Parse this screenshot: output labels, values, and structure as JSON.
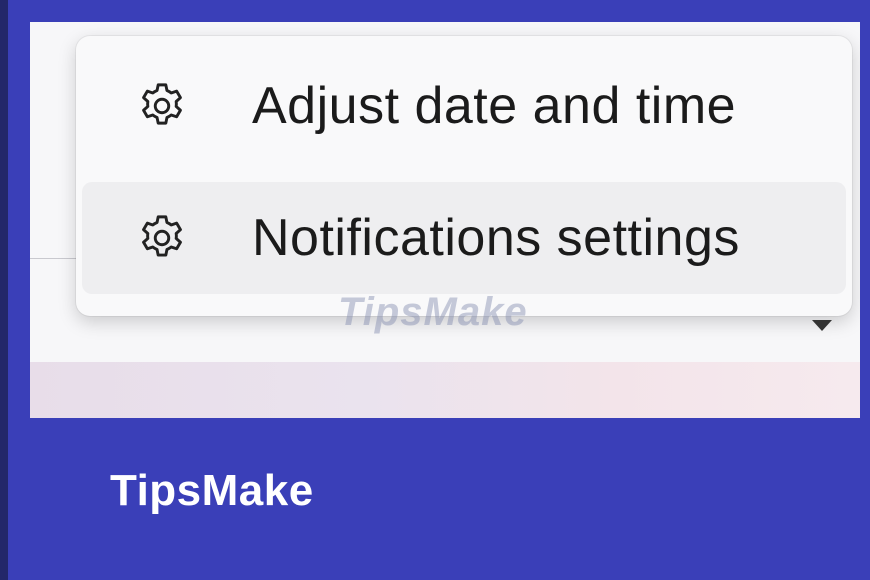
{
  "menu": {
    "items": [
      {
        "label": "Adjust date and time",
        "icon": "gear-icon"
      },
      {
        "label": "Notifications settings",
        "icon": "gear-icon"
      }
    ]
  },
  "watermark": {
    "text": "TipsMake"
  },
  "brand": {
    "text": "TipsMake"
  },
  "clock": {
    "partial_text": ""
  },
  "colors": {
    "frame_blue": "#3a3fb8",
    "menu_background": "#f9f9fa",
    "hover_background": "#eeeef0",
    "text": "#1b1b1b"
  }
}
